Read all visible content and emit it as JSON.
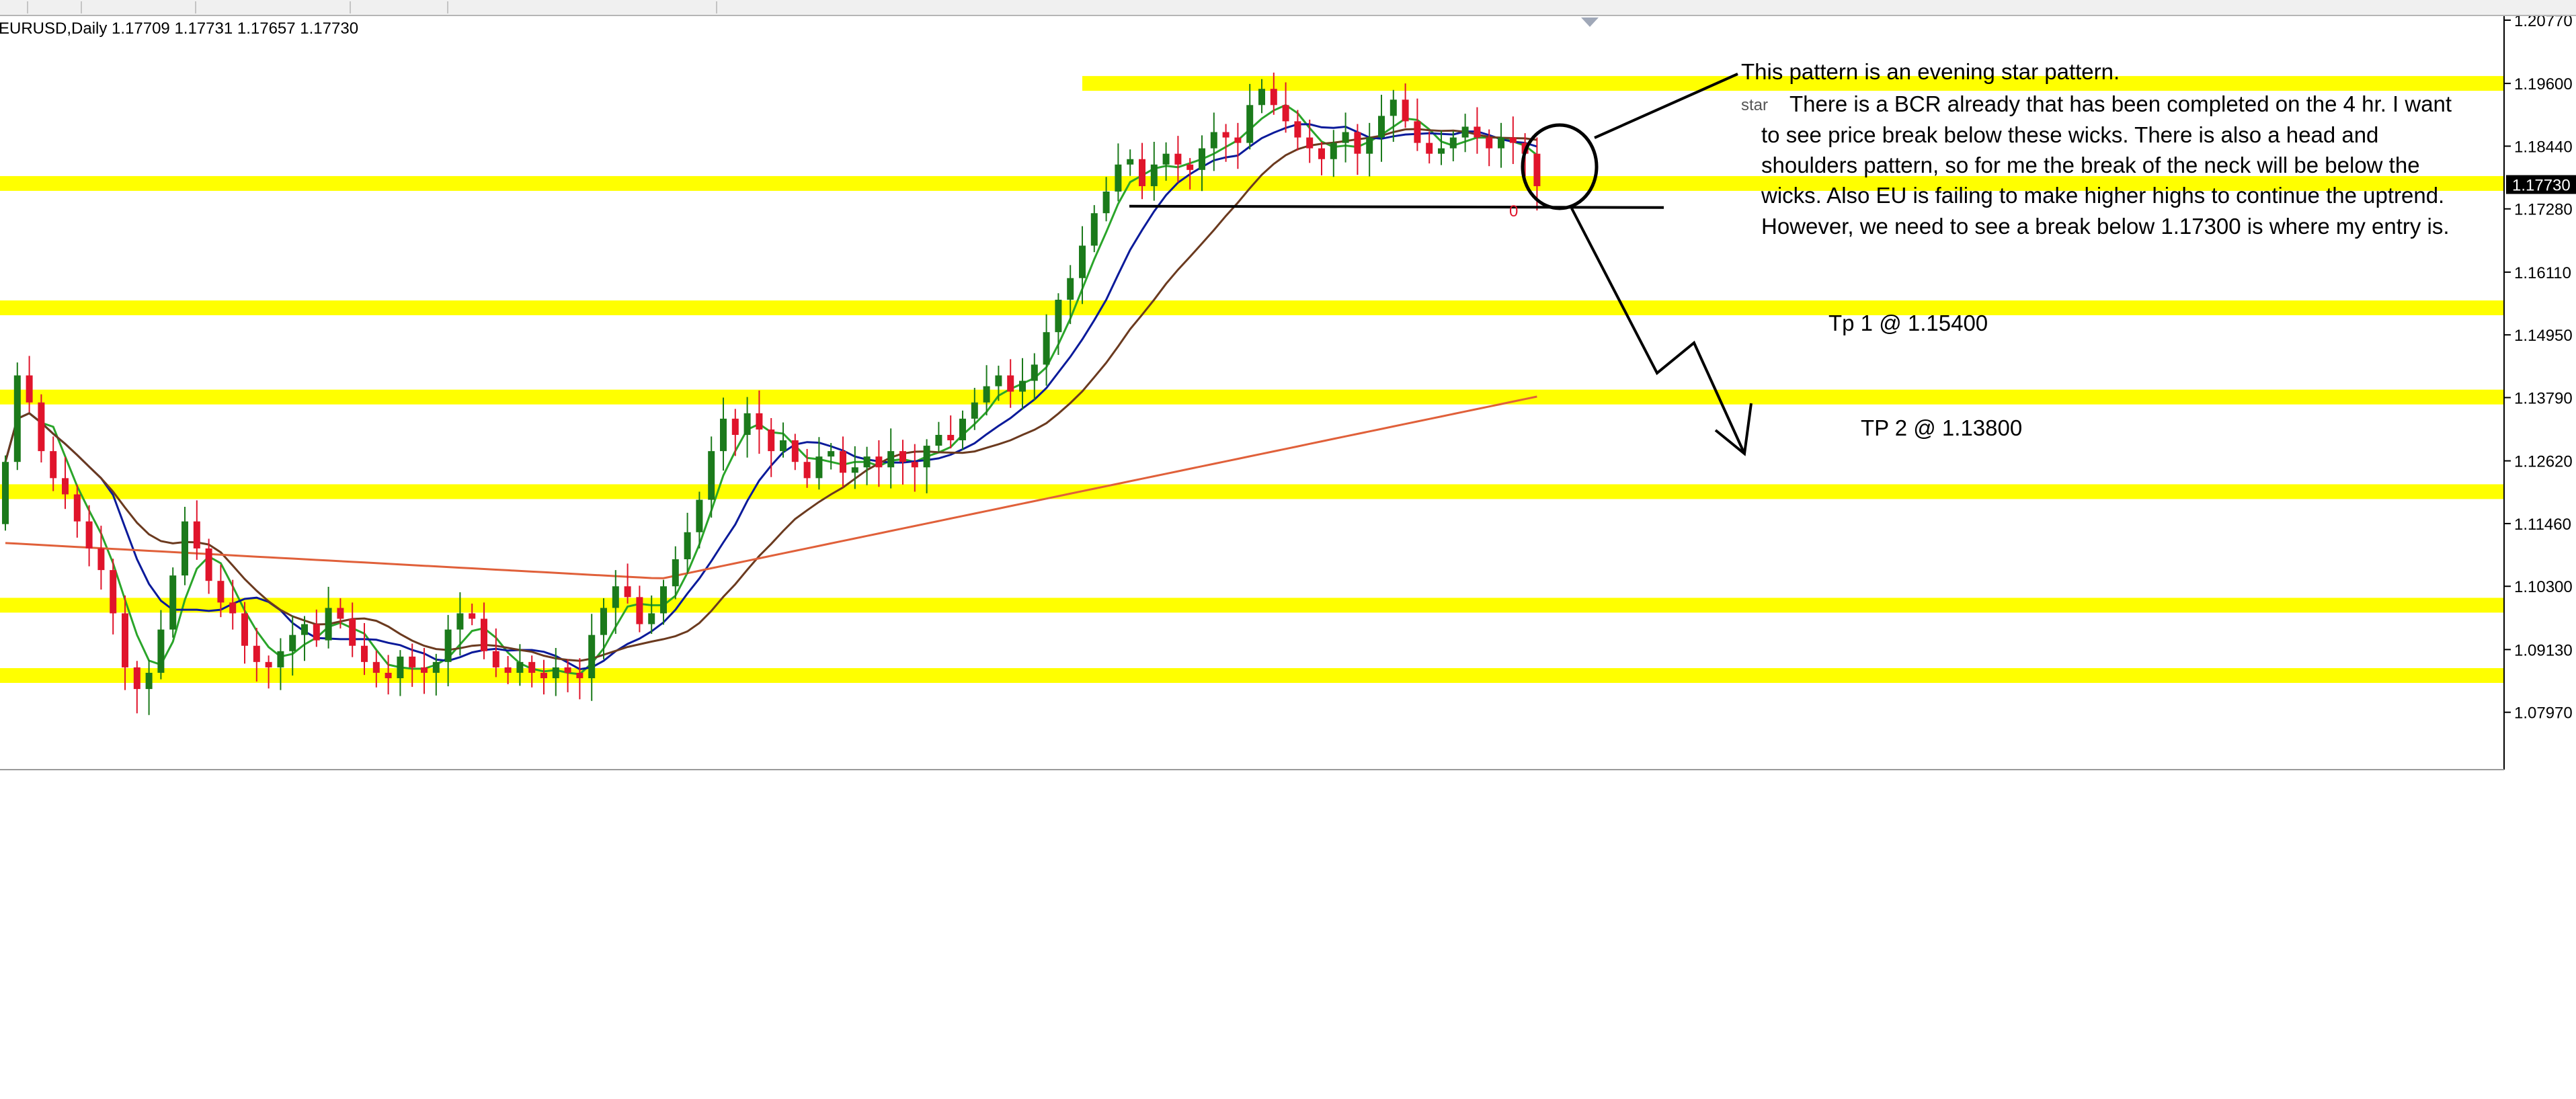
{
  "toolbar": {
    "separators": 6
  },
  "chart_data": {
    "type": "candlestick",
    "symbol_header": "EURUSD,Daily  1.17709 1.17731 1.17657 1.17730",
    "current_price": "1.17730",
    "y_ticks": [
      "1.20770",
      "1.19600",
      "1.18440",
      "1.17280",
      "1.16110",
      "1.14950",
      "1.13790",
      "1.12620",
      "1.11460",
      "1.10300",
      "1.09130",
      "1.07970"
    ],
    "ylim": [
      1.0722,
      1.2077
    ],
    "grid": false,
    "colors": {
      "bull": "#1b7a1b",
      "bear": "#e0142b",
      "zone": "#ffff00",
      "ma_fast": "#2aa52a",
      "ma_mid": "#0a1a9a",
      "ma_slow": "#6b3a1f",
      "ma_long": "#e0603a",
      "annotation": "#000000"
    },
    "support_resistance_zones": [
      {
        "price": 1.196,
        "from_candle": 90
      },
      {
        "price": 1.1775,
        "from_candle": 0
      },
      {
        "price": 1.1545,
        "from_candle": 0
      },
      {
        "price": 1.138,
        "from_candle": 0
      },
      {
        "price": 1.1205,
        "from_candle": 0
      },
      {
        "price": 1.0995,
        "from_candle": 0
      },
      {
        "price": 1.0865,
        "from_candle": 0
      }
    ],
    "neckline": {
      "price": 1.1733,
      "from_candle": 96,
      "to_candle": 142
    },
    "candles_close": [
      1.126,
      1.142,
      1.137,
      1.128,
      1.123,
      1.12,
      1.115,
      1.11,
      1.106,
      1.098,
      1.088,
      1.084,
      1.087,
      1.095,
      1.105,
      1.115,
      1.11,
      1.104,
      1.1,
      1.098,
      1.092,
      1.089,
      1.088,
      1.091,
      1.094,
      1.096,
      1.093,
      1.099,
      1.097,
      1.092,
      1.089,
      1.087,
      1.086,
      1.09,
      1.088,
      1.087,
      1.089,
      1.095,
      1.098,
      1.097,
      1.091,
      1.088,
      1.087,
      1.089,
      1.087,
      1.086,
      1.088,
      1.087,
      1.086,
      1.094,
      1.099,
      1.103,
      1.101,
      1.096,
      1.098,
      1.103,
      1.108,
      1.113,
      1.119,
      1.128,
      1.134,
      1.131,
      1.135,
      1.132,
      1.128,
      1.13,
      1.126,
      1.123,
      1.127,
      1.128,
      1.124,
      1.125,
      1.127,
      1.125,
      1.128,
      1.126,
      1.125,
      1.129,
      1.131,
      1.13,
      1.134,
      1.137,
      1.14,
      1.142,
      1.139,
      1.141,
      1.144,
      1.15,
      1.156,
      1.16,
      1.166,
      1.172,
      1.176,
      1.181,
      1.182,
      1.177,
      1.181,
      1.183,
      1.181,
      1.18,
      1.184,
      1.187,
      1.186,
      1.185,
      1.192,
      1.195,
      1.192,
      1.189,
      1.186,
      1.184,
      1.182,
      1.185,
      1.187,
      1.183,
      1.186,
      1.19,
      1.193,
      1.189,
      1.185,
      1.183,
      1.184,
      1.186,
      1.188,
      1.186,
      1.184,
      1.186,
      1.185,
      1.183,
      1.177
    ],
    "annotations": {
      "pattern_note": "This pattern is an evening  star pattern.",
      "overlap_word": "star",
      "body_lines": [
        "There is a BCR already that has been completed on the 4 hr. I want",
        "to see price break below these wicks. There is also a head and",
        "shoulders pattern, so for me the break of the neck will be below the",
        "wicks. Also EU is failing to make higher highs to continue the uptrend.",
        "However, we need to see a break below 1.17300 is where my entry is."
      ],
      "tp1": "Tp 1 @ 1.15400",
      "tp2": "TP 2 @ 1.13800"
    }
  }
}
